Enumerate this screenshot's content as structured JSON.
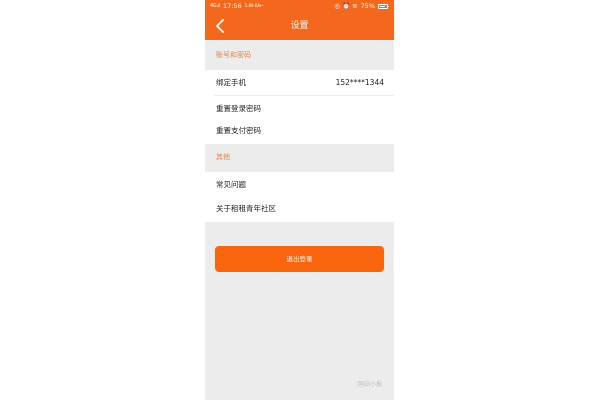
{
  "status_bar": {
    "signal": "4G.ıl",
    "time": "17:56",
    "speed": "5.89 K/s",
    "dots": "···",
    "icons": "◎ ⏰ ≋",
    "battery_percent": "75%",
    "battery_level": 0.75
  },
  "navbar": {
    "back_icon": "chevron-left-icon",
    "title": "设置"
  },
  "sections": {
    "account": {
      "header": "账号和密码",
      "bind_phone_label": "绑定手机",
      "bind_phone_value": "152****1344",
      "reset_login_pwd_label": "重置登录密码",
      "reset_pay_pwd_label": "重置支付密码"
    },
    "other": {
      "header": "其他",
      "faq_label": "常见问题",
      "about_label": "关于租租青年社区"
    }
  },
  "logout_button": "退出登录",
  "watermark": "网站小报",
  "colors": {
    "brand": "#f3681d",
    "button": "#f9650d",
    "section_header_text": "#e2854b",
    "background": "#ececec"
  }
}
